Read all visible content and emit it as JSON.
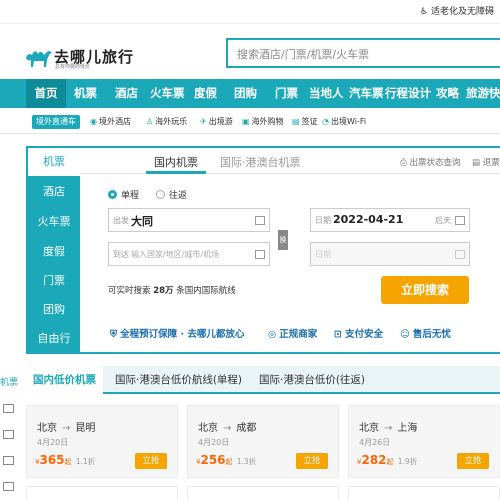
{
  "top": {
    "accessibility": "适老化及无障碍"
  },
  "brand": {
    "name": "去哪儿旅行",
    "slogan": "总有你要的低价"
  },
  "search": {
    "placeholder": "搜索酒店/门票/机票/火车票"
  },
  "nav": [
    "首页",
    "机票",
    "酒店",
    "火车票",
    "度假",
    "团购",
    "门票",
    "当地人",
    "汽车票",
    "行程设计",
    "攻略",
    "旅游快讯"
  ],
  "subnav": {
    "tag": "境外直通车",
    "links": [
      "境外酒店",
      "海外玩乐",
      "出境游",
      "海外购物",
      "签证",
      "出境Wi-Fi"
    ]
  },
  "panel": {
    "side": [
      "机票",
      "酒店",
      "火车票",
      "度假",
      "门票",
      "团购",
      "自由行"
    ],
    "tabs": {
      "domestic": "国内机票",
      "intl": "国际·港澳台机票",
      "status": "出票状态查询",
      "refund": "退票改签"
    },
    "trip": {
      "oneway": "单程",
      "round": "往返"
    },
    "from_label": "出发",
    "from_value": "大同",
    "to_label": "到达",
    "to_placeholder": "输入国家/地区/城市/机场",
    "date_label": "日期",
    "date_value": "2022-04-21",
    "date_day": "后天",
    "return_label": "日期",
    "swap": "换",
    "info_prefix": "可实时搜索",
    "info_count": "28万",
    "info_suffix": "条国内国际航线",
    "search_button": "立即搜索",
    "guarantees": [
      "全程预订保障 · 去哪儿都放心",
      "正规商家",
      "支付安全",
      "售后无忧"
    ]
  },
  "lowprice": {
    "tabs": [
      "国内低价机票",
      "国际·港澳台低价航线(单程)",
      "国际·港澳台低价(往返)"
    ],
    "side_label": "机票",
    "cards": [
      {
        "from": "北京",
        "to": "昆明",
        "date": "4月20日",
        "price": "365",
        "unit": "起",
        "discount": "1.1折",
        "button": "立抢"
      },
      {
        "from": "北京",
        "to": "成都",
        "date": "4月20日",
        "price": "256",
        "unit": "起",
        "discount": "1.3折",
        "button": "立抢"
      },
      {
        "from": "北京",
        "to": "上海",
        "date": "4月26日",
        "price": "282",
        "unit": "起",
        "discount": "1.9折",
        "button": "立抢"
      }
    ]
  },
  "colors": {
    "brand": "#1ba9ba",
    "accent": "#f6a400",
    "price": "#ff6600"
  }
}
